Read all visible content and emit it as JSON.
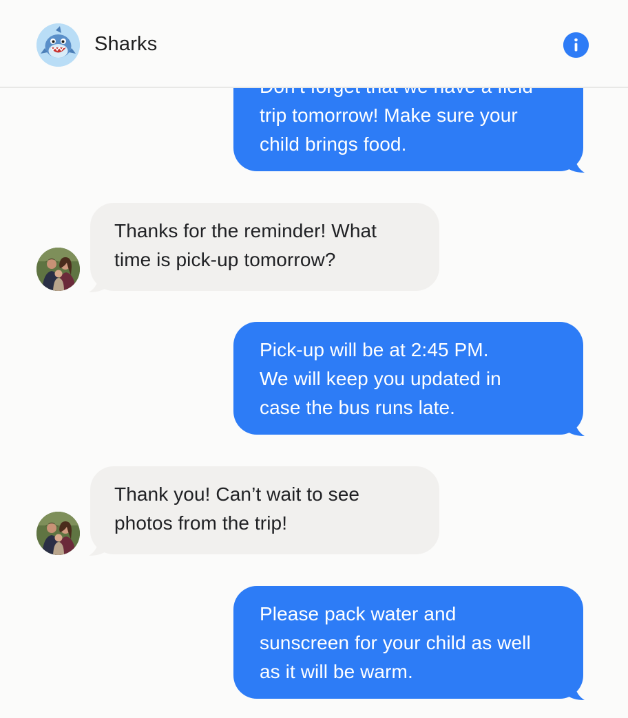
{
  "header": {
    "group_name": "Sharks",
    "group_avatar_icon": "shark-icon",
    "info_icon": "info-icon",
    "info_label": "i"
  },
  "colors": {
    "accent": "#2d7cf6",
    "incoming_bubble": "#f1f0ee",
    "background": "#fbfbfa"
  },
  "messages": [
    {
      "direction": "outgoing",
      "lines": [
        "Don’t forget that we have a field",
        "trip tomorrow! Make sure your",
        "child brings food."
      ]
    },
    {
      "direction": "incoming",
      "lines": [
        "Thanks for the reminder! What",
        "time is pick-up tomorrow?"
      ]
    },
    {
      "direction": "outgoing",
      "lines": [
        "Pick-up will be at 2:45 PM.",
        "We will keep you updated in",
        "case the bus runs late."
      ]
    },
    {
      "direction": "incoming",
      "lines": [
        "Thank you! Can’t wait to see",
        "photos from the trip!"
      ]
    },
    {
      "direction": "outgoing",
      "lines": [
        "Please pack water and",
        "sunscreen for your child as well",
        "as it will be warm."
      ]
    }
  ]
}
